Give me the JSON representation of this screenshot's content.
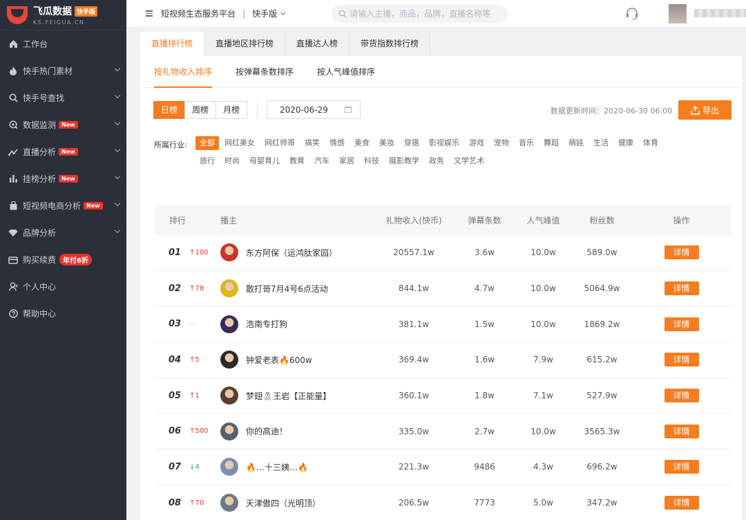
{
  "brand": {
    "title": "飞瓜数据",
    "badge": "快手版",
    "sub": "KS.FEIGUA.CN"
  },
  "sidebar": {
    "items": [
      {
        "label": "工作台",
        "icon": "home-icon"
      },
      {
        "label": "快手热门素材",
        "icon": "fire-icon"
      },
      {
        "label": "快手号查找",
        "icon": "search-icon"
      },
      {
        "label": "数据监测",
        "icon": "monitor-icon",
        "badge": "New"
      },
      {
        "label": "直播分析",
        "icon": "trend-icon",
        "badge": "New"
      },
      {
        "label": "挂榜分析",
        "icon": "bar-chart-icon",
        "badge": "New"
      },
      {
        "label": "短视频电商分析",
        "icon": "shopping-bag-icon",
        "badge": "New"
      },
      {
        "label": "品牌分析",
        "icon": "diamond-icon"
      },
      {
        "label": "购买续费",
        "icon": "wallet-icon",
        "promo": "年付6折"
      },
      {
        "label": "个人中心",
        "icon": "user-icon"
      },
      {
        "label": "帮助中心",
        "icon": "help-icon"
      }
    ]
  },
  "topbar": {
    "platform": "短视频生态服务平台",
    "separator": "|",
    "version": "快手版",
    "search_placeholder": "请输入主播，商品，品牌，直播名称等"
  },
  "tabs": [
    "直播排行榜",
    "直播地区排行榜",
    "直播达人榜",
    "带货指数排行榜"
  ],
  "subtabs": [
    "按礼物收入排序",
    "按弹幕条数排序",
    "按人气峰值排序"
  ],
  "period": [
    "日榜",
    "周榜",
    "月榜"
  ],
  "date": "2020-06-29",
  "updated": "数据更新时间：2020-06-30 06:00",
  "export_label": "导出",
  "industry": {
    "label": "所属行业:",
    "row1": [
      "全部",
      "网红美女",
      "网红帅哥",
      "搞笑",
      "情感",
      "美食",
      "美妆",
      "穿搭",
      "影视娱乐",
      "游戏",
      "宠物",
      "音乐",
      "舞蹈",
      "萌娃",
      "生活",
      "健康",
      "体育"
    ],
    "row2": [
      "旅行",
      "时尚",
      "母婴育儿",
      "教育",
      "汽车",
      "家居",
      "科技",
      "摄影教学",
      "政务",
      "文学艺术"
    ]
  },
  "table": {
    "headers": [
      "排行",
      "播主",
      "礼物收入(快币)",
      "弹幕条数",
      "人气峰值",
      "粉丝数",
      "操作"
    ],
    "detail_label": "详情",
    "rows": [
      {
        "rank": "01",
        "change": "↑100",
        "dir": "up",
        "name": "东方阿保（运鸿肽家园）",
        "gift": "20557.1w",
        "danmu": "3.6w",
        "peak": "10.0w",
        "fans": "589.0w",
        "color": "#c8332a"
      },
      {
        "rank": "02",
        "change": "↑78",
        "dir": "up",
        "name": "散打哥7月4号6点活动",
        "gift": "844.1w",
        "danmu": "4.7w",
        "peak": "10.0w",
        "fans": "5064.9w",
        "color": "#e0b41c"
      },
      {
        "rank": "03",
        "change": "--",
        "dir": "same",
        "name": "浩南专打狗",
        "gift": "381.1w",
        "danmu": "1.5w",
        "peak": "10.0w",
        "fans": "1869.2w",
        "color": "#3a2a55"
      },
      {
        "rank": "04",
        "change": "↑5",
        "dir": "up",
        "name": "钟爱老表🔥600w",
        "gift": "369.4w",
        "danmu": "1.6w",
        "peak": "7.9w",
        "fans": "615.2w",
        "color": "#2a2a2a"
      },
      {
        "rank": "05",
        "change": "↑1",
        "dir": "up",
        "name": "梦翅🎗王岩【正能量】",
        "gift": "360.1w",
        "danmu": "1.8w",
        "peak": "7.1w",
        "fans": "527.9w",
        "color": "#5a4030"
      },
      {
        "rank": "06",
        "change": "↑500",
        "dir": "up",
        "name": "你的高迪！",
        "gift": "335.0w",
        "danmu": "2.7w",
        "peak": "10.0w",
        "fans": "3565.3w",
        "color": "#556070"
      },
      {
        "rank": "07",
        "change": "↓4",
        "dir": "down",
        "name": "🔥…十三姨…🔥",
        "gift": "221.3w",
        "danmu": "9486",
        "peak": "4.3w",
        "fans": "696.2w",
        "color": "#7a90b0"
      },
      {
        "rank": "08",
        "change": "↑70",
        "dir": "up",
        "name": "天津傲四（光明顶）",
        "gift": "206.5w",
        "danmu": "7773",
        "peak": "5.0w",
        "fans": "347.2w",
        "color": "#6a7a8a"
      }
    ]
  },
  "colors": {
    "accent": "#f57c1f",
    "sidebar": "#2b2f3a",
    "up": "#e8332c",
    "down": "#2cab6c"
  }
}
